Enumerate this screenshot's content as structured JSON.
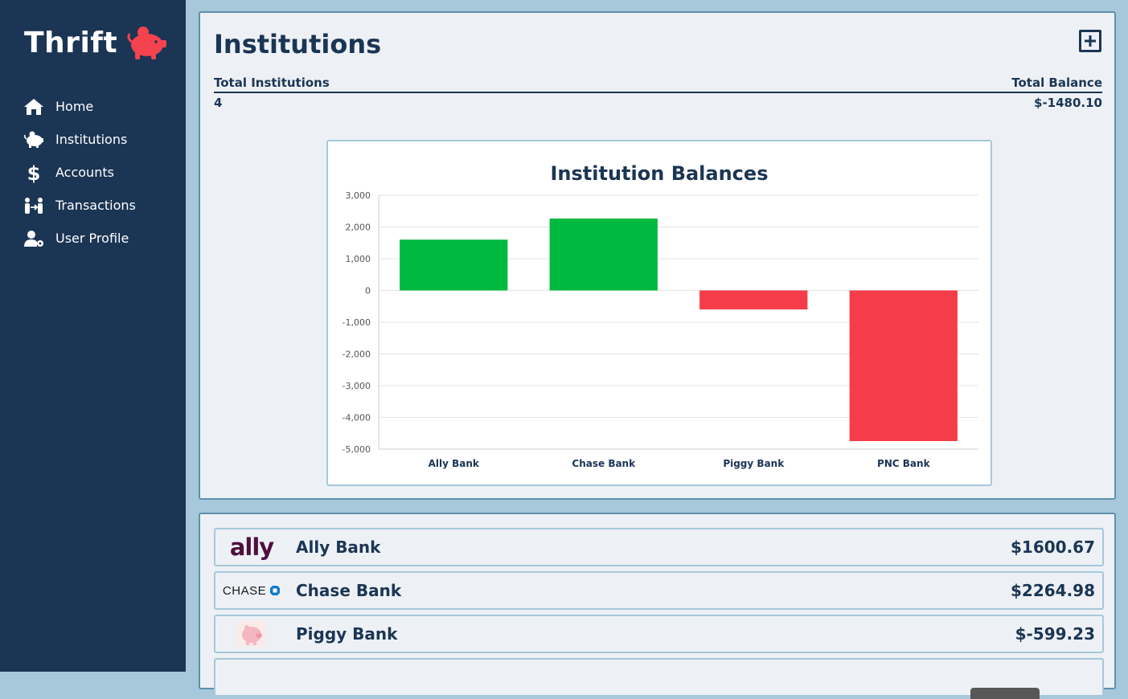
{
  "app": {
    "name": "Thrift"
  },
  "nav": [
    {
      "label": "Home",
      "icon": "home-icon"
    },
    {
      "label": "Institutions",
      "icon": "piggy-bank-icon"
    },
    {
      "label": "Accounts",
      "icon": "dollar-icon"
    },
    {
      "label": "Transactions",
      "icon": "transfer-icon"
    },
    {
      "label": "User Profile",
      "icon": "user-settings-icon"
    }
  ],
  "page": {
    "title": "Institutions",
    "summary": {
      "total_institutions_label": "Total Institutions",
      "total_balance_label": "Total Balance",
      "total_institutions": "4",
      "total_balance": "$-1480.10"
    }
  },
  "chart_data": {
    "type": "bar",
    "title": "Institution Balances",
    "categories": [
      "Ally Bank",
      "Chase Bank",
      "Piggy Bank",
      "PNC Bank"
    ],
    "values": [
      1600.67,
      2264.98,
      -599.23,
      -4746.52
    ],
    "ylim": [
      -5000,
      3000
    ],
    "yticks": [
      3000,
      2000,
      1000,
      0,
      -1000,
      -2000,
      -3000,
      -4000,
      -5000
    ],
    "ytick_labels": [
      "3,000",
      "2,000",
      "1,000",
      "0",
      "-1,000",
      "-2,000",
      "-3,000",
      "-4,000",
      "-5,000"
    ],
    "positive_color": "#00b93f",
    "negative_color": "#f43d48",
    "grid": true
  },
  "institutions": [
    {
      "name": "Ally Bank",
      "balance": "$1600.67",
      "logo_text": "ally"
    },
    {
      "name": "Chase Bank",
      "balance": "$2264.98",
      "logo_text": "CHASE"
    },
    {
      "name": "Piggy Bank",
      "balance": "$-599.23",
      "logo_text": ""
    }
  ],
  "colors": {
    "navy": "#1b3554",
    "accent_red": "#f4424f",
    "bg": "#a7c8da"
  }
}
